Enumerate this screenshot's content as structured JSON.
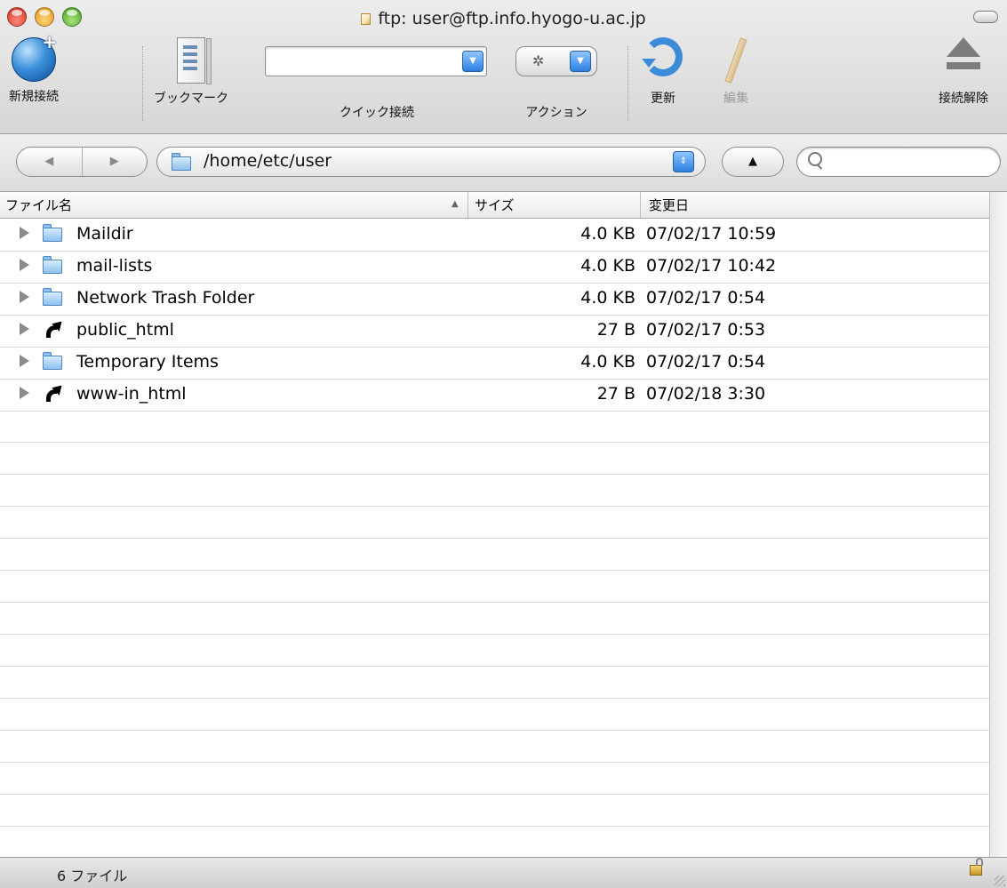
{
  "window": {
    "title": "ftp: user@ftp.info.hyogo-u.ac.jp"
  },
  "toolbar": {
    "new_connection": "新規接続",
    "bookmarks": "ブックマーク",
    "quick_connect": "クイック接続",
    "quick_connect_value": "",
    "action": "アクション",
    "refresh": "更新",
    "edit": "編集",
    "disconnect": "接続解除"
  },
  "navigation": {
    "back_glyph": "◀",
    "forward_glyph": "▶",
    "path": "/home/etc/user",
    "up_glyph": "▲",
    "search_value": ""
  },
  "columns": {
    "name": "ファイル名",
    "size": "サイズ",
    "modified": "変更日"
  },
  "files": [
    {
      "name": "Maildir",
      "size": "4.0 KB",
      "modified": "07/02/17 10:59",
      "icon": "folder-icon"
    },
    {
      "name": "mail-lists",
      "size": "4.0 KB",
      "modified": "07/02/17 10:42",
      "icon": "folder-icon"
    },
    {
      "name": "Network Trash Folder",
      "size": "4.0 KB",
      "modified": "07/02/17 0:54",
      "icon": "folder-icon"
    },
    {
      "name": "public_html",
      "size": "27 B",
      "modified": "07/02/17 0:53",
      "icon": "symlink-icon"
    },
    {
      "name": "Temporary Items",
      "size": "4.0 KB",
      "modified": "07/02/17 0:54",
      "icon": "folder-icon"
    },
    {
      "name": "www-in_html",
      "size": "27 B",
      "modified": "07/02/18 3:30",
      "icon": "symlink-icon"
    }
  ],
  "status": {
    "file_count": "6 ファイル"
  },
  "colors": {
    "accent_blue": "#2d7fe0",
    "folder_blue": "#8ec0ea"
  }
}
